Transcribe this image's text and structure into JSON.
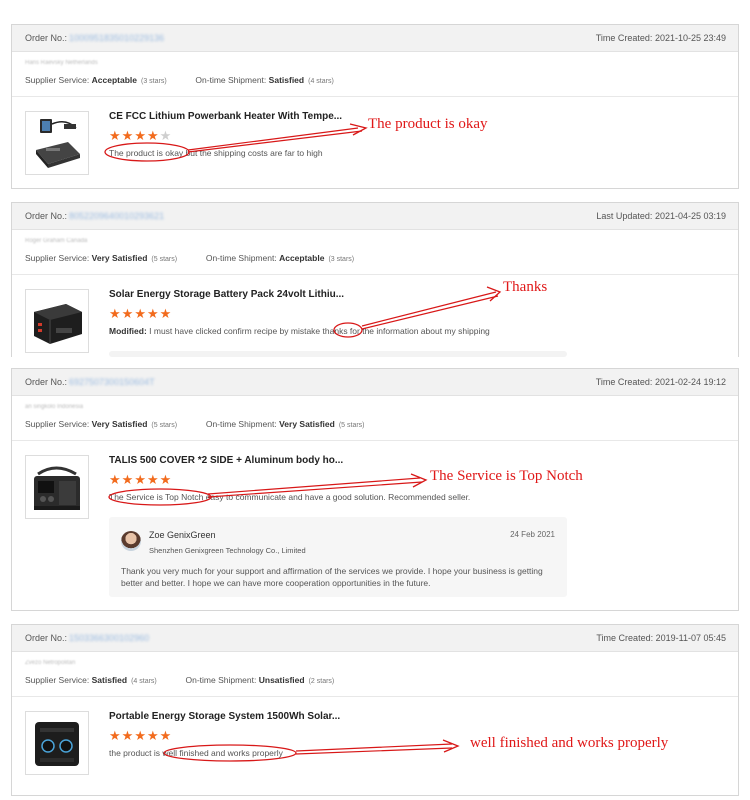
{
  "orders": [
    {
      "order_label": "Order No.:",
      "order_number": "1000951835010229136",
      "time_label": "Time Created:",
      "time_value": "2021-10-25 23:49",
      "buyer": "Hans Raevsky Netherlands",
      "supplier_service_label": "Supplier Service:",
      "supplier_service_value": "Acceptable",
      "supplier_service_stars": "(3 stars)",
      "shipment_label": "On-time Shipment:",
      "shipment_value": "Satisfied",
      "shipment_stars": "(4 stars)",
      "product_title": "CE FCC Lithium Powerbank Heater With Tempe...",
      "rating": 4,
      "review_text": "The product is okay but the shipping costs are far to high",
      "annotation": "The product is okay"
    },
    {
      "order_label": "Order No.:",
      "order_number": "8052209640010293621",
      "time_label": "Last Updated:",
      "time_value": "2021-04-25 03:19",
      "buyer": "Roger Graham Canada",
      "supplier_service_label": "Supplier Service:",
      "supplier_service_value": "Very Satisfied",
      "supplier_service_stars": "(5 stars)",
      "shipment_label": "On-time Shipment:",
      "shipment_value": "Acceptable",
      "shipment_stars": "(3 stars)",
      "product_title": "Solar Energy Storage Battery Pack 24volt Lithiu...",
      "rating": 5,
      "review_modified_label": "Modified:",
      "review_text": "I must have clicked confirm recipe by mistake thanks for the information about my shipping",
      "annotation": "Thanks"
    },
    {
      "order_label": "Order No.:",
      "order_number": "6927507300150604T",
      "time_label": "Time Created:",
      "time_value": "2021-02-24 19:12",
      "buyer": "an singkolo Indonesia",
      "supplier_service_label": "Supplier Service:",
      "supplier_service_value": "Very Satisfied",
      "supplier_service_stars": "(5 stars)",
      "shipment_label": "On-time Shipment:",
      "shipment_value": "Very Satisfied",
      "shipment_stars": "(5 stars)",
      "product_title": "TALIS 500 COVER *2 SIDE + Aluminum body ho...",
      "rating": 5,
      "review_text": "The Service is Top Notch easy to communicate and have a good solution. Recommended seller.",
      "annotation": "The Service is Top Notch",
      "reply": {
        "name": "Zoe GenixGreen",
        "company": "Shenzhen Genixgreen Technology Co., Limited",
        "date": "24 Feb 2021",
        "text": "Thank you very much for your support and affirmation of the services we provide. I hope your business is getting better and better. I hope we can have more cooperation opportunities in the future."
      }
    },
    {
      "order_label": "Order No.:",
      "order_number": "1503366300102960",
      "time_label": "Time Created:",
      "time_value": "2019-11-07 05:45",
      "buyer": "Zvezo Netropolitan",
      "supplier_service_label": "Supplier Service:",
      "supplier_service_value": "Satisfied",
      "supplier_service_stars": "(4 stars)",
      "shipment_label": "On-time Shipment:",
      "shipment_value": "Unsatisfied",
      "shipment_stars": "(2 stars)",
      "product_title": "Portable Energy Storage System 1500Wh Solar...",
      "rating": 5,
      "review_text": "the product is well finished and works properly",
      "annotation": "well finished and works properly"
    }
  ],
  "colors": {
    "star": "#f26b1d",
    "annotation": "#e01818",
    "header_bg": "#f2f2f2"
  }
}
